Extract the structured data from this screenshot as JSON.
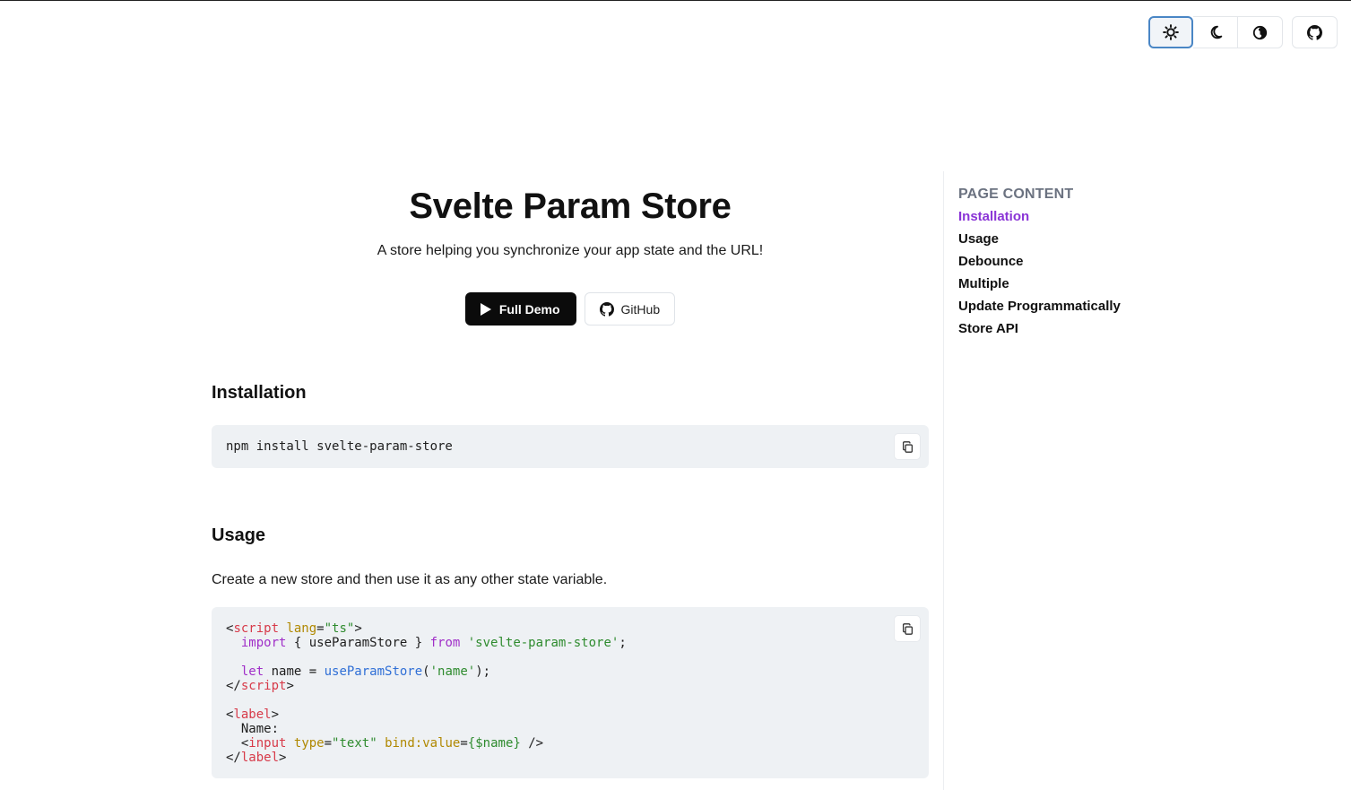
{
  "toolbar": {
    "theme_buttons": [
      {
        "name": "light",
        "icon": "sun-icon",
        "active": true
      },
      {
        "name": "dark",
        "icon": "moon-icon",
        "active": false
      },
      {
        "name": "system",
        "icon": "half-circle-icon",
        "active": false
      }
    ],
    "github_icon": "github-icon"
  },
  "hero": {
    "title": "Svelte Param Store",
    "subtitle": "A store helping you synchronize your app state and the URL!",
    "demo_label": "Full Demo",
    "github_label": "GitHub"
  },
  "installation": {
    "heading": "Installation",
    "code": "npm install svelte-param-store"
  },
  "usage": {
    "heading": "Usage",
    "description": "Create a new store and then use it as any other state variable."
  },
  "toc": {
    "title": "PAGE CONTENT",
    "items": [
      {
        "label": "Installation",
        "active": true
      },
      {
        "label": "Usage",
        "active": false
      },
      {
        "label": "Debounce",
        "active": false
      },
      {
        "label": "Multiple",
        "active": false
      },
      {
        "label": "Update Programmatically",
        "active": false
      },
      {
        "label": "Store API",
        "active": false
      }
    ]
  },
  "colors": {
    "accent": "#8a34d6",
    "code_bg": "#eef1f4",
    "active_border": "#4a86c5"
  }
}
